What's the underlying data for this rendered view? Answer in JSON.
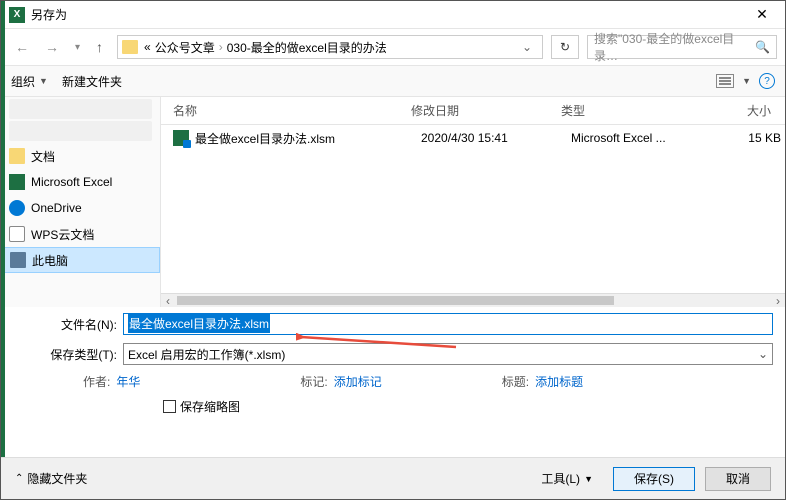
{
  "title": "另存为",
  "path": {
    "prefix": "«",
    "seg1": "公众号文章",
    "seg2": "030-最全的做excel目录的办法"
  },
  "search_placeholder": "搜索\"030-最全的做excel目录…",
  "toolbar": {
    "organize": "组织",
    "newfolder": "新建文件夹"
  },
  "columns": {
    "name": "名称",
    "date": "修改日期",
    "type": "类型",
    "size": "大小"
  },
  "file": {
    "name": "最全做excel目录办法.xlsm",
    "date": "2020/4/30 15:41",
    "type": "Microsoft Excel ...",
    "size": "15 KB"
  },
  "sidebar": {
    "docs": "文档",
    "excel": "Microsoft Excel",
    "onedrive": "OneDrive",
    "wps": "WPS云文档",
    "pc": "此电脑"
  },
  "form": {
    "filename_label": "文件名(N):",
    "filename_value": "最全做excel目录办法.xlsm",
    "type_label": "保存类型(T):",
    "type_value": "Excel 启用宏的工作簿(*.xlsm)"
  },
  "meta": {
    "author_label": "作者:",
    "author_value": "年华",
    "tags_label": "标记:",
    "tags_value": "添加标记",
    "title_label": "标题:",
    "title_value": "添加标题"
  },
  "thumb": "保存缩略图",
  "footer": {
    "hide": "隐藏文件夹",
    "tools": "工具(L)",
    "save": "保存(S)",
    "cancel": "取消"
  }
}
